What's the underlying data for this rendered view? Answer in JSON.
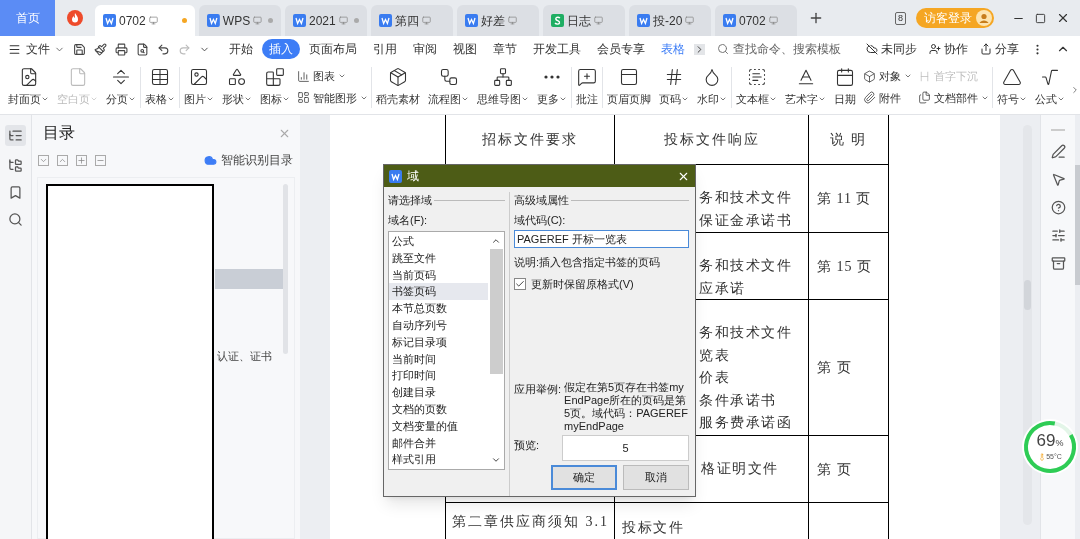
{
  "title_bar": {
    "home_tab": "首页",
    "tabs": [
      {
        "label": "0702",
        "kind": "writer",
        "selected": true,
        "dot": true
      },
      {
        "label": "WPS",
        "kind": "writer",
        "selected": false,
        "dot": true
      },
      {
        "label": "2021",
        "kind": "writer",
        "selected": false,
        "dot": true
      },
      {
        "label": "第四",
        "kind": "writer",
        "selected": false,
        "dot": false
      },
      {
        "label": "好差",
        "kind": "writer",
        "selected": false,
        "dot": false
      },
      {
        "label": "日志",
        "kind": "sheet",
        "selected": false,
        "dot": false
      },
      {
        "label": "投-20",
        "kind": "writer",
        "selected": false,
        "dot": false
      },
      {
        "label": "0702",
        "kind": "writer",
        "selected": false,
        "dot": false
      }
    ],
    "badge": "8",
    "login": "访客登录"
  },
  "menu_bar": {
    "file": "文件",
    "tabs": [
      {
        "label": "开始",
        "selected": false,
        "contextual": false
      },
      {
        "label": "插入",
        "selected": true,
        "contextual": false
      },
      {
        "label": "页面布局",
        "selected": false,
        "contextual": false
      },
      {
        "label": "引用",
        "selected": false,
        "contextual": false
      },
      {
        "label": "审阅",
        "selected": false,
        "contextual": false
      },
      {
        "label": "视图",
        "selected": false,
        "contextual": false
      },
      {
        "label": "章节",
        "selected": false,
        "contextual": false
      },
      {
        "label": "开发工具",
        "selected": false,
        "contextual": false
      },
      {
        "label": "会员专享",
        "selected": false,
        "contextual": false
      },
      {
        "label": "表格",
        "selected": false,
        "contextual": true
      }
    ],
    "search": {
      "placeholder": "查找命令、搜索模板"
    },
    "actions": [
      "未同步",
      "协作",
      "分享"
    ]
  },
  "toolbar_groups": [
    [
      {
        "kind": "big",
        "label": "封面页",
        "dropdown": true,
        "disabled": false
      },
      {
        "kind": "big",
        "label": "空白页",
        "dropdown": true,
        "disabled": true
      },
      {
        "kind": "big",
        "label": "分页",
        "dropdown": true,
        "disabled": false
      }
    ],
    [
      {
        "kind": "big",
        "label": "表格",
        "dropdown": true,
        "disabled": false
      }
    ],
    [
      {
        "kind": "big",
        "label": "图片",
        "dropdown": true,
        "disabled": false
      },
      {
        "kind": "big",
        "label": "形状",
        "dropdown": true,
        "disabled": false
      },
      {
        "kind": "big",
        "label": "图标",
        "dropdown": true,
        "disabled": false
      },
      {
        "kind": "stack",
        "items": [
          {
            "label": "图表",
            "dropdown": true,
            "disabled": false
          },
          {
            "label": "智能图形",
            "dropdown": true,
            "disabled": false
          }
        ]
      }
    ],
    [
      {
        "kind": "big",
        "label": "稻壳素材",
        "dropdown": false,
        "disabled": false
      },
      {
        "kind": "big",
        "label": "流程图",
        "dropdown": true,
        "disabled": false
      },
      {
        "kind": "big",
        "label": "思维导图",
        "dropdown": true,
        "disabled": false
      },
      {
        "kind": "big",
        "label": "更多",
        "dropdown": true,
        "disabled": false
      }
    ],
    [
      {
        "kind": "big",
        "label": "批注",
        "dropdown": false,
        "disabled": false
      }
    ],
    [
      {
        "kind": "big",
        "label": "页眉页脚",
        "dropdown": false,
        "disabled": false
      },
      {
        "kind": "big",
        "label": "页码",
        "dropdown": true,
        "disabled": false
      },
      {
        "kind": "big",
        "label": "水印",
        "dropdown": true,
        "disabled": false
      }
    ],
    [
      {
        "kind": "big",
        "label": "文本框",
        "dropdown": true,
        "disabled": false
      },
      {
        "kind": "big",
        "label": "艺术字",
        "dropdown": true,
        "disabled": false
      },
      {
        "kind": "big",
        "label": "日期",
        "dropdown": false,
        "disabled": false
      },
      {
        "kind": "stack",
        "items": [
          {
            "label": "对象",
            "dropdown": true,
            "disabled": false
          },
          {
            "label": "附件",
            "dropdown": false,
            "disabled": false
          }
        ]
      },
      {
        "kind": "stack",
        "items": [
          {
            "label": "首字下沉",
            "dropdown": false,
            "disabled": true
          },
          {
            "label": "文档部件",
            "dropdown": true,
            "disabled": false
          }
        ]
      }
    ],
    [
      {
        "kind": "big",
        "label": "符号",
        "dropdown": true,
        "disabled": false
      },
      {
        "kind": "big",
        "label": "公式",
        "dropdown": true,
        "disabled": false
      }
    ]
  ],
  "toc": {
    "title": "目录",
    "smart": "智能识别目录",
    "items": [
      {
        "selected": true
      },
      {
        "label": "认证、证书",
        "selected": false
      }
    ]
  },
  "document": {
    "columns": [
      "招标文件要求",
      "投标文件响应",
      "说 明"
    ],
    "rows": [
      {
        "response": [
          "务和技术文件",
          "保证金承诺书"
        ],
        "note": "第 11 页"
      },
      {
        "response": [
          "务和技术文件",
          "应承诺"
        ],
        "note": "第 15 页"
      },
      {
        "response": [
          "务和技术文件",
          "览表",
          "价表",
          "条件承诺书",
          "服务费承诺函"
        ],
        "note": "第 页"
      },
      {
        "response": [
          "格证明文件"
        ],
        "note": "第 页"
      },
      {
        "requirement": "第二章供应商须知 3.1",
        "response": [
          "投标文件"
        ]
      }
    ]
  },
  "dialog": {
    "title": "域",
    "left_group": "请选择域",
    "list_label": "域名(F):",
    "fields": [
      {
        "label": "公式",
        "selected": false
      },
      {
        "label": "跳至文件",
        "selected": false
      },
      {
        "label": "当前页码",
        "selected": false
      },
      {
        "label": "书签页码",
        "selected": true
      },
      {
        "label": "本节总页数",
        "selected": false
      },
      {
        "label": "自动序列号",
        "selected": false
      },
      {
        "label": "标记目录项",
        "selected": false
      },
      {
        "label": "当前时间",
        "selected": false
      },
      {
        "label": "打印时间",
        "selected": false
      },
      {
        "label": "创建目录",
        "selected": false
      },
      {
        "label": "文档的页数",
        "selected": false
      },
      {
        "label": "文档变量的值",
        "selected": false
      },
      {
        "label": "邮件合并",
        "selected": false
      },
      {
        "label": "样式引用",
        "selected": false
      }
    ],
    "right_group": "高级域属性",
    "code_label": "域代码(C):",
    "code_value": "PAGEREF 开标一览表",
    "description": "说明:插入包含指定书签的页码",
    "keep_format": {
      "label": "更新时保留原格式(V)",
      "checked": true
    },
    "example_label": "应用举例:",
    "example": "假定在第5页存在书签myEndPage所在的页码是第5页。域代码：PAGEREF myEndPage",
    "preview_label": "预览:",
    "preview": "5",
    "buttons": [
      {
        "label": "确定",
        "default": true
      },
      {
        "label": "取消",
        "default": false
      }
    ]
  },
  "monitor": {
    "percent": "69",
    "unit": "%",
    "temp": "55°C"
  }
}
